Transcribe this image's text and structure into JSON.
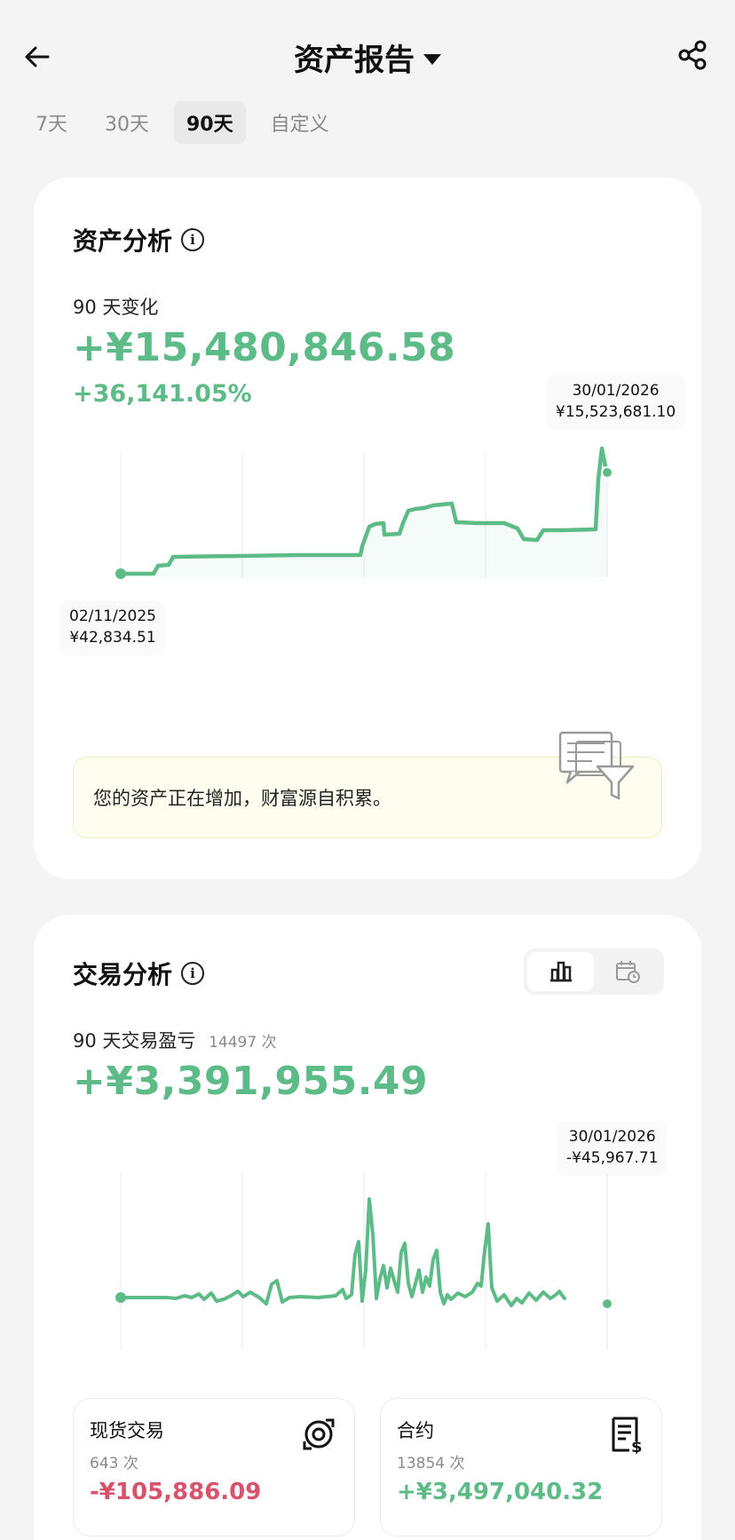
{
  "header": {
    "title": "资产报告",
    "back_icon": "arrow-left-icon",
    "share_icon": "share-icon"
  },
  "tabs": [
    {
      "label": "7天",
      "active": false
    },
    {
      "label": "30天",
      "active": false
    },
    {
      "label": "90天",
      "active": true
    },
    {
      "label": "自定义",
      "active": false
    }
  ],
  "asset_analysis": {
    "title": "资产分析",
    "change_label": "90 天变化",
    "change_value": "+¥15,480,846.58",
    "change_percent": "+36,141.05%",
    "start_tip": {
      "date": "02/11/2025",
      "value": "¥42,834.51"
    },
    "end_tip": {
      "date": "30/01/2026",
      "value": "¥15,523,681.10"
    },
    "insight": "您的资产正在增加，财富源自积累。",
    "colors": {
      "positive": "#5dbb87"
    }
  },
  "trade_analysis": {
    "title": "交易分析",
    "pnl_label": "90 天交易盈亏",
    "trade_count": "14497 次",
    "pnl_value": "+¥3,391,955.49",
    "end_tip": {
      "date": "30/01/2026",
      "value": "-¥45,967.71"
    },
    "toggle_icons": [
      "bar-chart-icon",
      "calendar-clock-icon"
    ],
    "spot": {
      "label": "现货交易",
      "count": "643 次",
      "value": "-¥105,886.09"
    },
    "futures": {
      "label": "合约",
      "count": "13854 次",
      "value": "+¥3,497,040.32"
    },
    "colors": {
      "negative": "#d7526a",
      "positive": "#5dbb87"
    }
  }
}
